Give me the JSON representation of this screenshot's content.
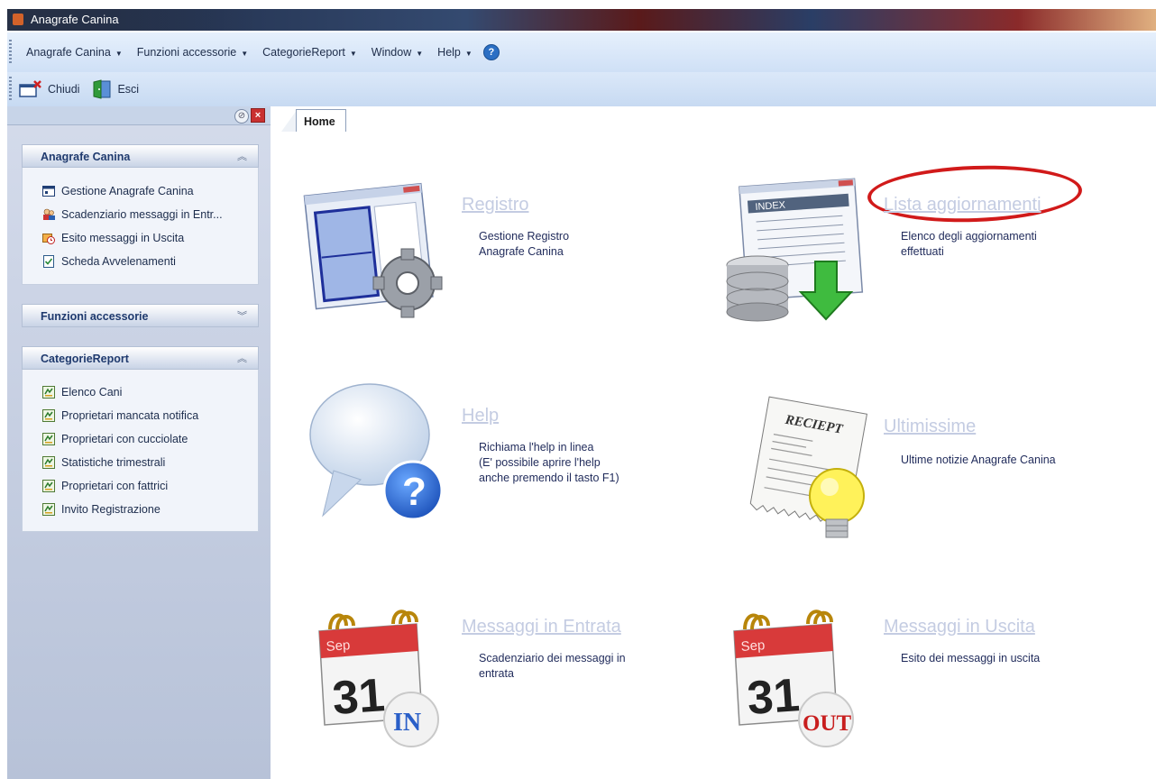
{
  "window": {
    "title": "Anagrafe Canina"
  },
  "menu": {
    "items": [
      {
        "label": "Anagrafe Canina"
      },
      {
        "label": "Funzioni accessorie"
      },
      {
        "label": "CategorieReport"
      },
      {
        "label": "Window"
      },
      {
        "label": "Help"
      }
    ]
  },
  "toolbar": {
    "close_label": "Chiudi",
    "exit_label": "Esci"
  },
  "sidebar": {
    "groups": [
      {
        "title": "Anagrafe Canina",
        "expanded": true,
        "items": [
          {
            "label": "Gestione Anagrafe Canina",
            "icon": "window-icon"
          },
          {
            "label": "Scadenziario messaggi in Entr...",
            "icon": "people-icon"
          },
          {
            "label": "Esito messaggi in Uscita",
            "icon": "clock-folder-icon"
          },
          {
            "label": "Scheda Avvelenamenti",
            "icon": "checklist-icon"
          }
        ]
      },
      {
        "title": "Funzioni accessorie",
        "expanded": false,
        "items": []
      },
      {
        "title": "CategorieReport",
        "expanded": true,
        "items": [
          {
            "label": "Elenco Cani",
            "icon": "report-icon"
          },
          {
            "label": "Proprietari mancata notifica",
            "icon": "report-icon"
          },
          {
            "label": "Proprietari con cucciolate",
            "icon": "report-icon"
          },
          {
            "label": "Statistiche trimestrali",
            "icon": "report-icon"
          },
          {
            "label": "Proprietari con fattrici",
            "icon": "report-icon"
          },
          {
            "label": "Invito Registrazione",
            "icon": "report-icon"
          }
        ]
      }
    ]
  },
  "tabs": [
    {
      "label": "Home",
      "active": true
    }
  ],
  "tiles": [
    {
      "title": "Registro",
      "description": "Gestione Registro\n Anagrafe Canina",
      "icon": "registry-gear-icon"
    },
    {
      "title": "Lista aggiornamenti",
      "description": "Elenco degli aggiornamenti\neffettuati",
      "icon": "database-download-icon"
    },
    {
      "title": "Help",
      "description": "Richiama l'help in linea\n(E' possibile aprire l'help\nanche premendo il tasto F1)",
      "icon": "help-bubble-icon"
    },
    {
      "title": "Ultimissime",
      "description": "Ultime notizie Anagrafe Canina",
      "icon": "receipt-bulb-icon"
    },
    {
      "title": "Messaggi in Entrata",
      "description": "Scadenziario dei messaggi in\nentrata",
      "icon": "calendar-in-icon"
    },
    {
      "title": "Messaggi in Uscita",
      "description": "Esito dei messaggi in uscita",
      "icon": "calendar-out-icon"
    }
  ],
  "calendar": {
    "month": "Sep",
    "day": "31",
    "in_badge": "IN",
    "out_badge": "OUT"
  },
  "receipt": {
    "heading": "RECIEPT"
  },
  "index_sheet": {
    "heading": "INDEX"
  },
  "colors": {
    "annotation_circle": "#d11a1a",
    "link_title": "#c4cce2",
    "sidebar_bg": "#c6cfe0"
  }
}
